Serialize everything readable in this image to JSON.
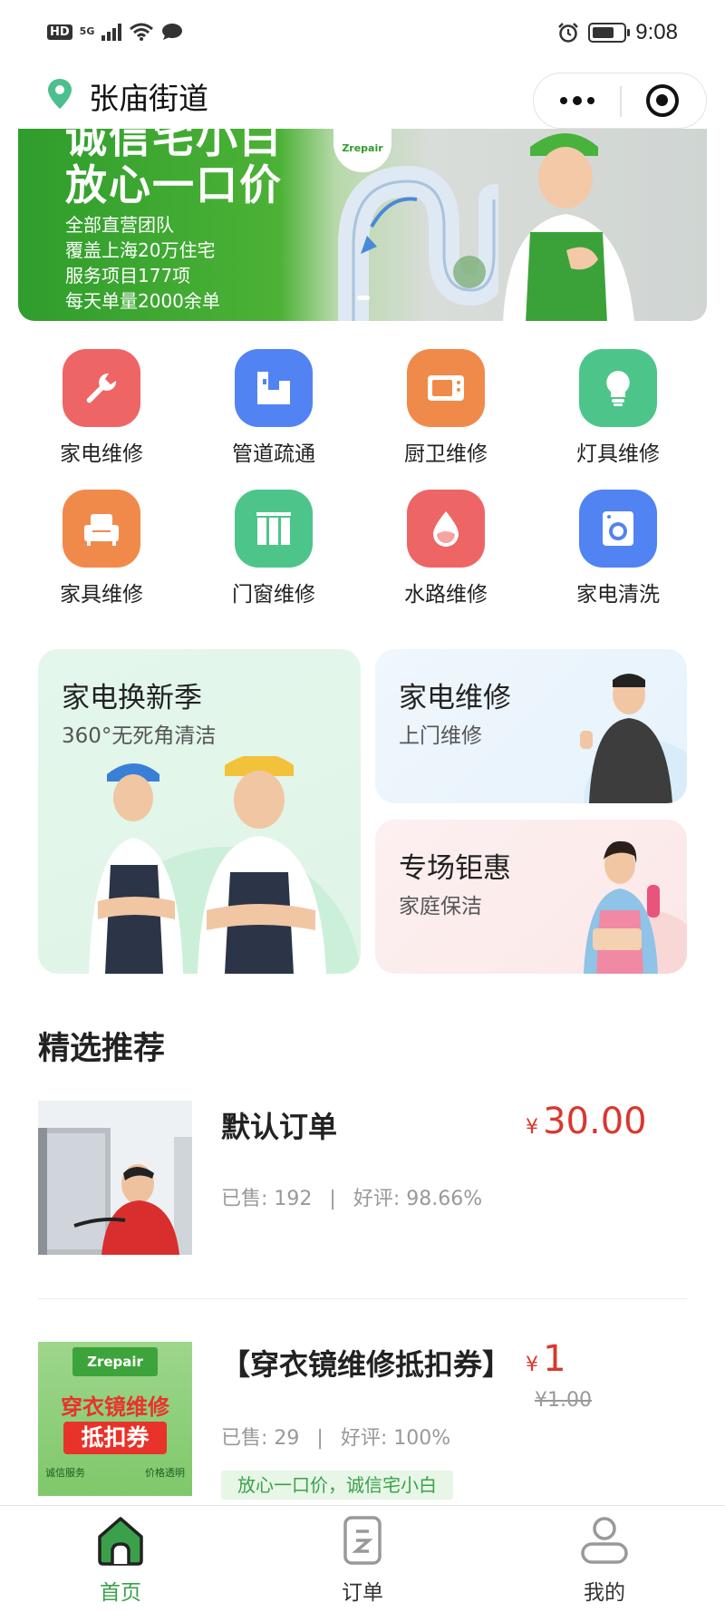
{
  "status_bar": {
    "hd": "HD",
    "network": "5G",
    "time": "9:08"
  },
  "header": {
    "location": "张庙街道"
  },
  "banner": {
    "slogan_line1": "诚信宅小白",
    "slogan_line2": "放心一口价",
    "line1": "全部直营团队",
    "line2": "覆盖上海20万住宅",
    "line3": "服务项目177项",
    "line4": "每天单量2000余单",
    "logo_text": "Zrepair"
  },
  "categories": [
    {
      "label": "家电维修",
      "color": "#ee6565",
      "icon": "wrench-icon"
    },
    {
      "label": "管道疏通",
      "color": "#5283f2",
      "icon": "pipe-icon"
    },
    {
      "label": "厨卫维修",
      "color": "#f08a4b",
      "icon": "microwave-icon"
    },
    {
      "label": "灯具维修",
      "color": "#4dc58a",
      "icon": "bulb-icon"
    },
    {
      "label": "家具维修",
      "color": "#f08a4b",
      "icon": "sofa-icon"
    },
    {
      "label": "门窗维修",
      "color": "#4dc58a",
      "icon": "window-icon"
    },
    {
      "label": "水路维修",
      "color": "#ee6565",
      "icon": "water-drop-icon"
    },
    {
      "label": "家电清洗",
      "color": "#5283f2",
      "icon": "washer-icon"
    }
  ],
  "promos": {
    "big": {
      "title": "家电换新季",
      "subtitle": "360°无死角清洁"
    },
    "top": {
      "title": "家电维修",
      "subtitle": "上门维修"
    },
    "bottom": {
      "title": "专场钜惠",
      "subtitle": "家庭保洁"
    }
  },
  "section": {
    "title": "精选推荐"
  },
  "products": [
    {
      "title": "默认订单",
      "currency": "¥",
      "price": "30.00",
      "sold": "已售: 192",
      "sep": "|",
      "rating": "好评: 98.66%"
    },
    {
      "title": "【穿衣镜维修抵扣券】",
      "currency": "¥",
      "price": "1",
      "original": "¥1.00",
      "sold": "已售: 29",
      "sep": "|",
      "rating": "好评: 100%",
      "tag": "放心一口价，诚信宅小白",
      "img_logo": "Zrepair",
      "img_line1": "穿衣镜维修",
      "img_line2": "抵扣券",
      "img_badge1": "诚信服务",
      "img_badge2": "价格透明"
    }
  ],
  "tabbar": {
    "home": "首页",
    "orders": "订单",
    "mine": "我的",
    "active_color": "#3aa14a"
  }
}
